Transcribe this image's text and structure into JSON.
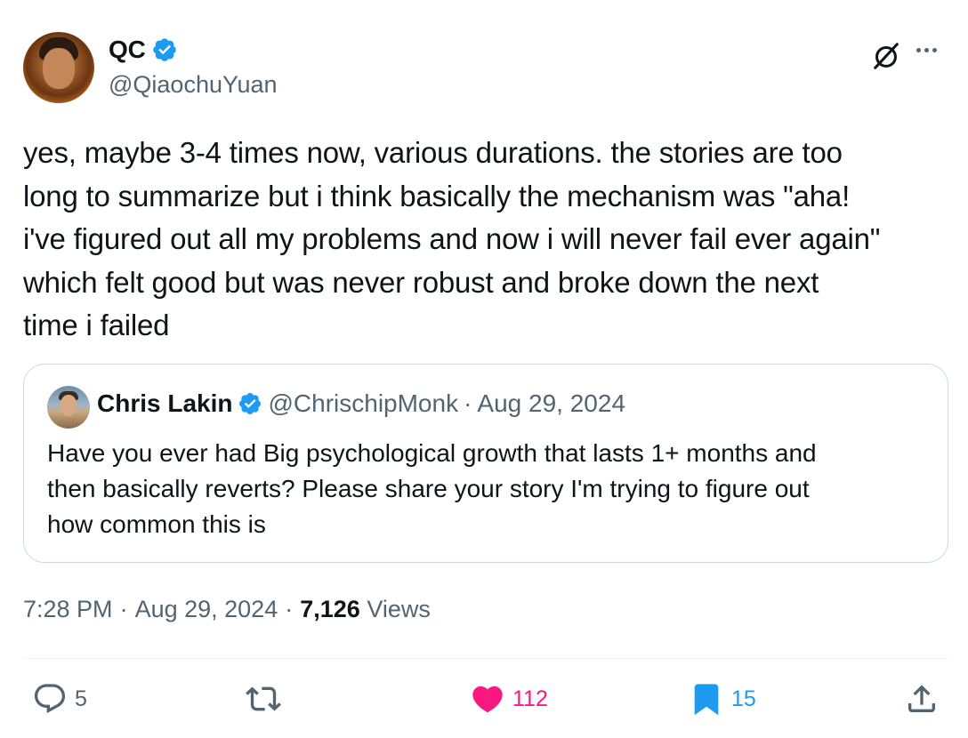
{
  "author": {
    "name": "QC",
    "handle": "@QiaochuYuan",
    "verified": true
  },
  "tweet": {
    "text": "yes, maybe 3-4 times now, various durations. the stories are too\nlong to summarize but i think basically the mechanism was \"aha!\ni've figured out all my problems and now i will never fail ever again\"\nwhich felt good but was never robust and broke down the next\ntime i failed"
  },
  "quote": {
    "name": "Chris Lakin",
    "handle": "@ChrischipMonk",
    "separator": "·",
    "date": "Aug 29, 2024",
    "text": "Have you ever had Big psychological growth that lasts 1+ months and\nthen basically reverts? Please share your story I'm trying to figure out\nhow common this is"
  },
  "meta": {
    "time": "7:28 PM",
    "sep1": "·",
    "date": "Aug 29, 2024",
    "sep2": "·",
    "views_count": "7,126",
    "views_label": "Views"
  },
  "actions": {
    "replies": "5",
    "reposts": "",
    "likes": "112",
    "bookmarks": "15"
  },
  "colors": {
    "accent": "#1d9bf0",
    "like": "#f91880",
    "secondary_text": "#536471",
    "border": "#cfd9de"
  },
  "icons": [
    "verified-badge-icon",
    "grok-icon",
    "more-icon",
    "reply-icon",
    "repost-icon",
    "heart-icon",
    "bookmark-icon",
    "share-icon"
  ]
}
